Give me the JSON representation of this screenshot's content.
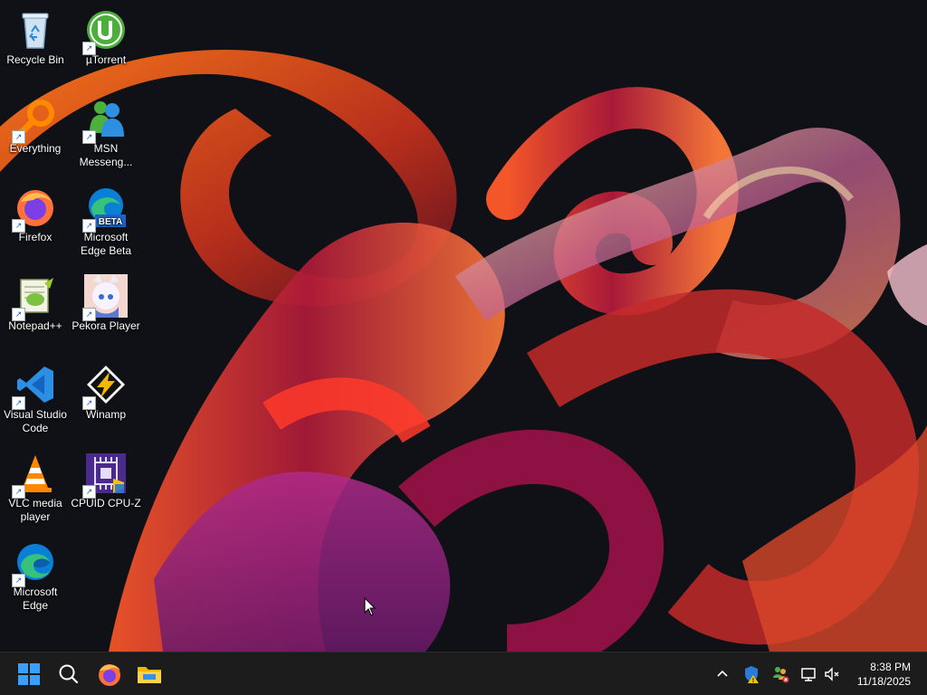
{
  "desktop": {
    "icons": [
      {
        "label": "Recycle Bin",
        "icon": "recycle-bin-icon"
      },
      {
        "label": "Everything",
        "icon": "everything-search-icon"
      },
      {
        "label": "Firefox",
        "icon": "firefox-icon"
      },
      {
        "label": "Notepad++",
        "icon": "notepadpp-icon"
      },
      {
        "label": "Visual Studio Code",
        "icon": "vscode-icon"
      },
      {
        "label": "VLC media player",
        "icon": "vlc-icon"
      },
      {
        "label": "Microsoft Edge",
        "icon": "edge-icon"
      },
      {
        "label": "µTorrent",
        "icon": "utorrent-icon"
      },
      {
        "label": "MSN Messeng...",
        "icon": "msn-messenger-icon"
      },
      {
        "label": "Microsoft Edge Beta",
        "icon": "edge-beta-icon",
        "badge": "BETA"
      },
      {
        "label": "Pekora Player",
        "icon": "pekora-player-icon"
      },
      {
        "label": "Winamp",
        "icon": "winamp-icon"
      },
      {
        "label": "CPUID CPU-Z",
        "icon": "cpuz-icon"
      }
    ]
  },
  "taskbar": {
    "pinned": [
      "windows-start-icon",
      "search-icon",
      "firefox-icon",
      "file-explorer-icon"
    ],
    "tray": [
      "chevron-up-icon",
      "security-warning-icon",
      "network-people-icon",
      "display-warning-icon",
      "volume-muted-icon"
    ],
    "clock": {
      "time": "8:38 PM",
      "date": "11/18/2025"
    }
  },
  "colors": {
    "taskbar_bg": "#1c1c1c",
    "start_blue": "#3aa0ff",
    "wallpaper_base": "#0f1117",
    "ribbon_orange": "#e8641a",
    "ribbon_red": "#c61a2a"
  }
}
